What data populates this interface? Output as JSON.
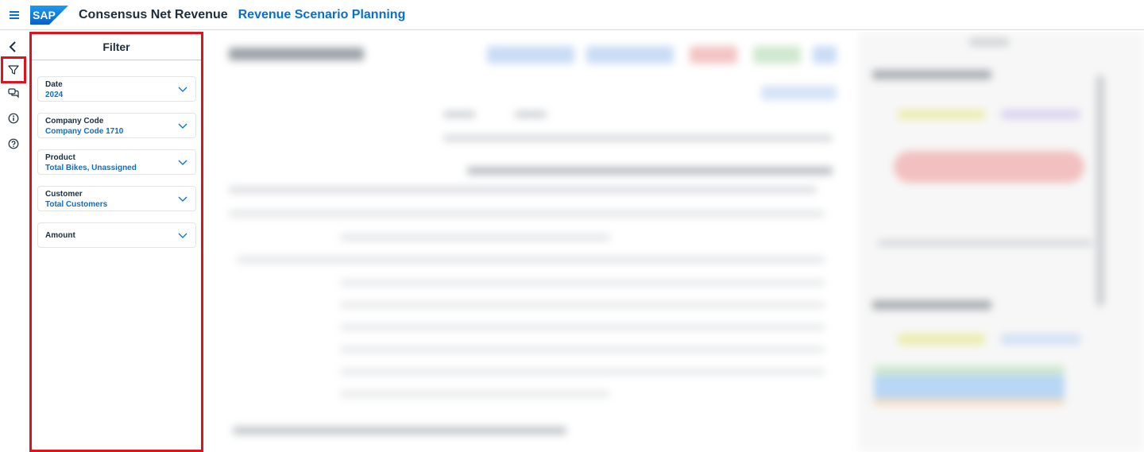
{
  "shell": {
    "menu_icon": "hamburger-icon",
    "logo_text": "SAP",
    "title": "Consensus Net Revenue",
    "subtitle": "Revenue Scenario Planning",
    "brand_color": "#0a6ed1"
  },
  "rail": {
    "items": [
      {
        "icon": "back-arrow-icon"
      },
      {
        "icon": "filter-icon",
        "active": true
      },
      {
        "icon": "discussion-icon"
      },
      {
        "icon": "info-icon"
      },
      {
        "icon": "help-icon"
      }
    ],
    "highlight_color": "#e0121b"
  },
  "filter": {
    "title": "Filter",
    "items": [
      {
        "label": "Date",
        "value": "2024"
      },
      {
        "label": "Company Code",
        "value": "Company Code 1710"
      },
      {
        "label": "Product",
        "value": "Total Bikes, Unassigned"
      },
      {
        "label": "Customer",
        "value": "Total Customers"
      },
      {
        "label": "Amount",
        "value": ""
      }
    ]
  }
}
